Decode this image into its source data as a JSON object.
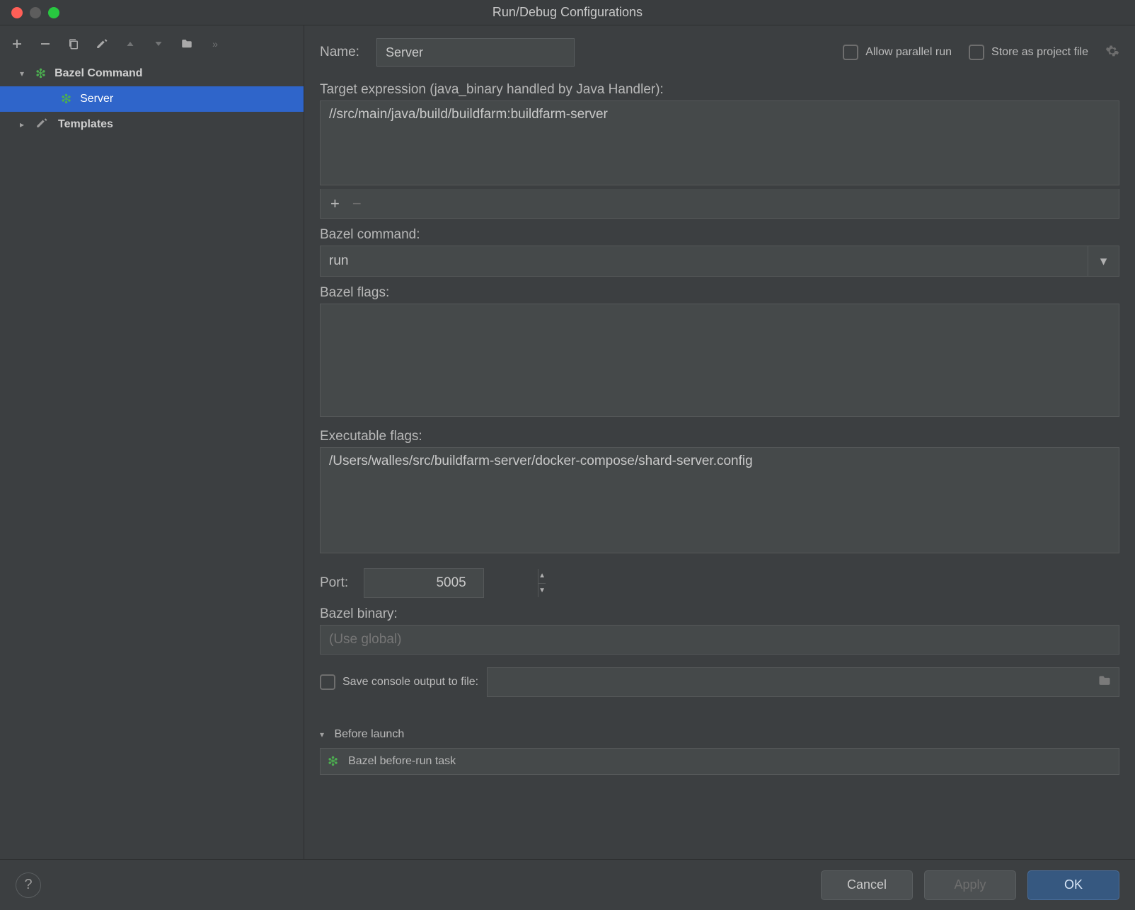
{
  "window": {
    "title": "Run/Debug Configurations"
  },
  "sidebar": {
    "group": "Bazel Command",
    "selected_item": "Server",
    "templates_label": "Templates"
  },
  "form": {
    "name_label": "Name:",
    "name_value": "Server",
    "allow_parallel_label": "Allow parallel run",
    "store_project_label": "Store as project file",
    "target_label": "Target expression (java_binary handled by Java Handler):",
    "target_value": "//src/main/java/build/buildfarm:buildfarm-server",
    "bazel_command_label": "Bazel command:",
    "bazel_command_value": "run",
    "bazel_flags_label": "Bazel flags:",
    "bazel_flags_value": "",
    "exec_flags_label": "Executable flags:",
    "exec_flags_value": "/Users/walles/src/buildfarm-server/docker-compose/shard-server.config",
    "port_label": "Port:",
    "port_value": "5005",
    "bazel_binary_label": "Bazel binary:",
    "bazel_binary_placeholder": "(Use global)",
    "save_console_label": "Save console output to file:",
    "before_launch_label": "Before launch",
    "before_launch_task": "Bazel before-run task"
  },
  "footer": {
    "help": "?",
    "cancel": "Cancel",
    "apply": "Apply",
    "ok": "OK"
  }
}
